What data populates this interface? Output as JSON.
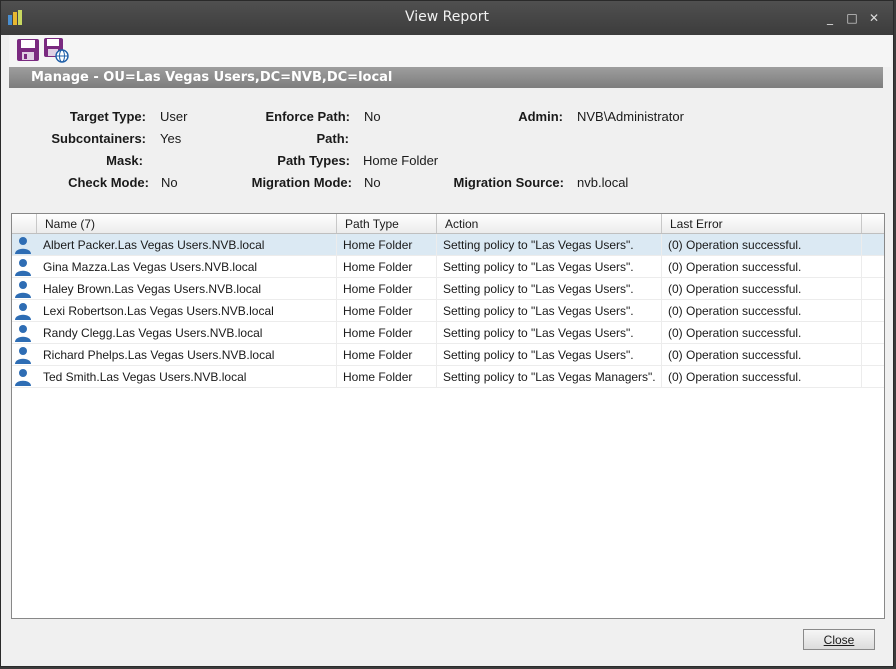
{
  "window": {
    "title": "View Report",
    "minimize": "_",
    "maximize": "□",
    "close": "✕"
  },
  "ou_bar": {
    "text": "Manage  -  OU=Las Vegas Users,DC=NVB,DC=local"
  },
  "info": {
    "target_type_label": "Target Type:",
    "target_type_value": "User",
    "subcontainers_label": "Subcontainers:",
    "subcontainers_value": "Yes",
    "mask_label": "Mask:",
    "mask_value": "",
    "check_mode_label": "Check Mode:",
    "check_mode_value": "No",
    "enforce_path_label": "Enforce Path:",
    "enforce_path_value": "No",
    "path_label": "Path:",
    "path_value": "",
    "path_types_label": "Path Types:",
    "path_types_value": "Home Folder",
    "migration_mode_label": "Migration Mode:",
    "migration_mode_value": "No",
    "admin_label": "Admin:",
    "admin_value": "NVB\\Administrator",
    "migration_source_label": "Migration Source:",
    "migration_source_value": "nvb.local"
  },
  "grid": {
    "headers": [
      "Name  (7)",
      "Path Type",
      "Action",
      "Last Error"
    ],
    "rows": [
      {
        "name": "Albert Packer.Las Vegas Users.NVB.local",
        "path_type": "Home Folder",
        "action": "Setting policy to \"Las Vegas Users\".",
        "last_error": "(0) Operation successful."
      },
      {
        "name": "Gina Mazza.Las Vegas Users.NVB.local",
        "path_type": "Home Folder",
        "action": "Setting policy to \"Las Vegas Users\".",
        "last_error": "(0) Operation successful."
      },
      {
        "name": "Haley Brown.Las Vegas Users.NVB.local",
        "path_type": "Home Folder",
        "action": "Setting policy to \"Las Vegas Users\".",
        "last_error": "(0) Operation successful."
      },
      {
        "name": "Lexi Robertson.Las Vegas Users.NVB.local",
        "path_type": "Home Folder",
        "action": "Setting policy to \"Las Vegas Users\".",
        "last_error": "(0) Operation successful."
      },
      {
        "name": "Randy Clegg.Las Vegas Users.NVB.local",
        "path_type": "Home Folder",
        "action": "Setting policy to \"Las Vegas Users\".",
        "last_error": "(0) Operation successful."
      },
      {
        "name": "Richard Phelps.Las Vegas Users.NVB.local",
        "path_type": "Home Folder",
        "action": "Setting policy to \"Las Vegas Users\".",
        "last_error": "(0) Operation successful."
      },
      {
        "name": "Ted Smith.Las Vegas Users.NVB.local",
        "path_type": "Home Folder",
        "action": "Setting policy to \"Las Vegas Managers\".",
        "last_error": "(0) Operation successful."
      }
    ]
  },
  "footer": {
    "close_label": "Close"
  },
  "colors": {
    "selected_row": "#dbe9f3",
    "titlebar": "#444444",
    "toolbar_icon": "#7a2a80"
  }
}
